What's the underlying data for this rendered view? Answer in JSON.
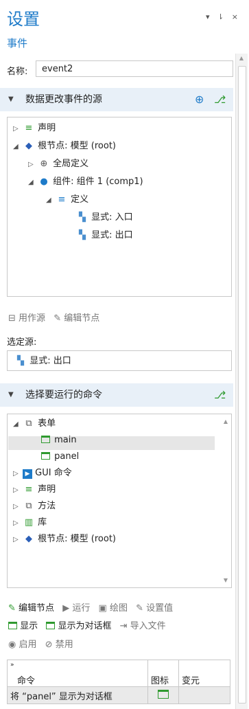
{
  "header": {
    "title": "设置",
    "subtitle": "事件",
    "controls": "▾ ⇂ ×"
  },
  "name_field": {
    "label": "名称:",
    "value": "event2"
  },
  "section1": {
    "title": "数据更改事件的源",
    "add_icon": "add-icon",
    "tree_icon": "tree-icon"
  },
  "source_tree": [
    {
      "label": "声明",
      "indent": 0,
      "toggle": "▷",
      "icon": "≡"
    },
    {
      "label": "根节点: 模型 (root)",
      "indent": 0,
      "toggle": "◢",
      "icon": "◆"
    },
    {
      "label": "全局定义",
      "indent": 1,
      "toggle": "▷",
      "icon": "⊕"
    },
    {
      "label": "组件: 组件 1 (comp1)",
      "indent": 1,
      "toggle": "◢",
      "icon": "●"
    },
    {
      "label": "定义",
      "indent": 2,
      "toggle": "◢",
      "icon": "≡"
    },
    {
      "label": "显式: 入口",
      "indent": 3,
      "toggle": "",
      "icon": "▚"
    },
    {
      "label": "显式: 出口",
      "indent": 3,
      "toggle": "",
      "icon": "▚"
    }
  ],
  "source_toolbar": {
    "use_as_source": "用作源",
    "edit_node": "编辑节点"
  },
  "selected_source": {
    "label": "选定源:",
    "value": "显式: 出口"
  },
  "section2": {
    "title": "选择要运行的命令"
  },
  "command_tree": [
    {
      "label": "表单",
      "indent": 0,
      "toggle": "◢",
      "icon": "form"
    },
    {
      "label": "main",
      "indent": 1,
      "toggle": "",
      "icon": "box"
    },
    {
      "label": "panel",
      "indent": 1,
      "toggle": "",
      "icon": "box",
      "selected": true
    },
    {
      "label": "GUI 命令",
      "indent": 0,
      "toggle": "▷",
      "icon": "gui"
    },
    {
      "label": "声明",
      "indent": 0,
      "toggle": "▷",
      "icon": "≡"
    },
    {
      "label": "方法",
      "indent": 0,
      "toggle": "▷",
      "icon": "method"
    },
    {
      "label": "库",
      "indent": 0,
      "toggle": "▷",
      "icon": "lib"
    },
    {
      "label": "根节点: 模型 (root)",
      "indent": 0,
      "toggle": "▷",
      "icon": "◆"
    }
  ],
  "command_toolbar": {
    "row1": [
      "编辑节点",
      "运行",
      "绘图",
      "设置值"
    ],
    "row2": [
      "显示",
      "显示为对话框",
      "导入文件"
    ],
    "row3": [
      "启用",
      "禁用"
    ]
  },
  "command_table": {
    "headers": [
      "命令",
      "图标",
      "变元"
    ],
    "rows": [
      {
        "command": "将 “panel” 显示为对话框",
        "icon": "",
        "args": ""
      }
    ]
  },
  "colors": {
    "accent": "#1e7bc9",
    "section_bg": "#e8f0f8",
    "green": "#2f9a2f"
  }
}
